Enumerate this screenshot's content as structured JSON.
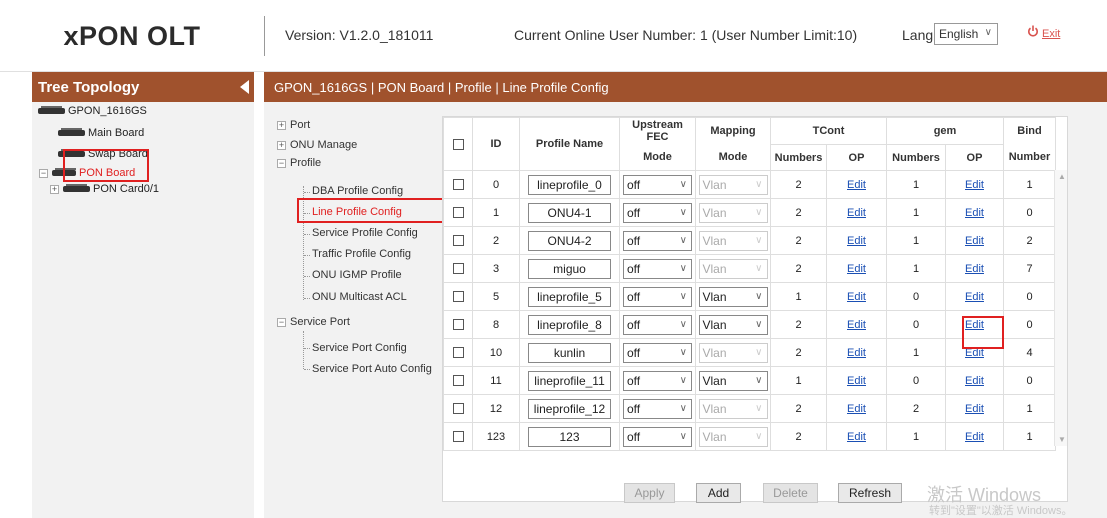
{
  "header": {
    "brand": "xPON OLT",
    "version": "Version: V1.2.0_181011",
    "online": "Current Online User Number: 1 (User Number Limit:10)",
    "lang_label": "Lang",
    "lang_value": "English",
    "exit_label": "Exit"
  },
  "tree": {
    "title": "Tree Topology",
    "root": "GPON_1616GS",
    "items": [
      "Main Board",
      "Swap Board",
      "PON Board",
      "PON Card0/1"
    ]
  },
  "main": {
    "breadcrumb": "GPON_1616GS | PON Board | Profile | Line Profile Config"
  },
  "menu": {
    "port": "Port",
    "onu_manage": "ONU Manage",
    "profile": "Profile",
    "profile_items": [
      "DBA Profile Config",
      "Line Profile Config",
      "Service Profile Config",
      "Traffic Profile Config",
      "ONU IGMP Profile",
      "ONU Multicast ACL"
    ],
    "service_port": "Service Port",
    "service_items": [
      "Service Port Config",
      "Service Port Auto Config"
    ]
  },
  "table": {
    "headers": {
      "id": "ID",
      "profile_name": "Profile Name",
      "upstream_fec": "Upstream FEC",
      "upstream_fec_sub": "Mode",
      "mapping": "Mapping",
      "mapping_sub": "Mode",
      "tcont": "TCont",
      "gem": "gem",
      "bind": "Bind",
      "numbers": "Numbers",
      "op": "OP",
      "bind_sub": "Number"
    },
    "rows": [
      {
        "id": "0",
        "name": "lineprofile_0",
        "fec": "off",
        "mapping": "Vlan",
        "mapping_enabled": false,
        "tcont": "2",
        "tcont_op": "Edit",
        "gem": "1",
        "gem_op": "Edit",
        "bind": "1"
      },
      {
        "id": "1",
        "name": "ONU4-1",
        "fec": "off",
        "mapping": "Vlan",
        "mapping_enabled": false,
        "tcont": "2",
        "tcont_op": "Edit",
        "gem": "1",
        "gem_op": "Edit",
        "bind": "0"
      },
      {
        "id": "2",
        "name": "ONU4-2",
        "fec": "off",
        "mapping": "Vlan",
        "mapping_enabled": false,
        "tcont": "2",
        "tcont_op": "Edit",
        "gem": "1",
        "gem_op": "Edit",
        "bind": "2"
      },
      {
        "id": "3",
        "name": "miguo",
        "fec": "off",
        "mapping": "Vlan",
        "mapping_enabled": false,
        "tcont": "2",
        "tcont_op": "Edit",
        "gem": "1",
        "gem_op": "Edit",
        "bind": "7"
      },
      {
        "id": "5",
        "name": "lineprofile_5",
        "fec": "off",
        "mapping": "Vlan",
        "mapping_enabled": true,
        "tcont": "1",
        "tcont_op": "Edit",
        "gem": "0",
        "gem_op": "Edit",
        "bind": "0"
      },
      {
        "id": "8",
        "name": "lineprofile_8",
        "fec": "off",
        "mapping": "Vlan",
        "mapping_enabled": true,
        "tcont": "2",
        "tcont_op": "Edit",
        "gem": "0",
        "gem_op": "Edit",
        "bind": "0"
      },
      {
        "id": "10",
        "name": "kunlin",
        "fec": "off",
        "mapping": "Vlan",
        "mapping_enabled": false,
        "tcont": "2",
        "tcont_op": "Edit",
        "gem": "1",
        "gem_op": "Edit",
        "bind": "4"
      },
      {
        "id": "11",
        "name": "lineprofile_11",
        "fec": "off",
        "mapping": "Vlan",
        "mapping_enabled": true,
        "tcont": "1",
        "tcont_op": "Edit",
        "gem": "0",
        "gem_op": "Edit",
        "bind": "0"
      },
      {
        "id": "12",
        "name": "lineprofile_12",
        "fec": "off",
        "mapping": "Vlan",
        "mapping_enabled": false,
        "tcont": "2",
        "tcont_op": "Edit",
        "gem": "2",
        "gem_op": "Edit",
        "bind": "1"
      },
      {
        "id": "123",
        "name": "123",
        "fec": "off",
        "mapping": "Vlan",
        "mapping_enabled": false,
        "tcont": "2",
        "tcont_op": "Edit",
        "gem": "1",
        "gem_op": "Edit",
        "bind": "1"
      }
    ]
  },
  "buttons": {
    "apply": "Apply",
    "add": "Add",
    "delete": "Delete",
    "refresh": "Refresh"
  },
  "watermark": {
    "line1": "激活 Windows",
    "line2": "转到\"设置\"以激活 Windows。"
  },
  "colors": {
    "accent": "#a0522d",
    "highlight": "#e02020",
    "link": "#1a4fb4"
  }
}
